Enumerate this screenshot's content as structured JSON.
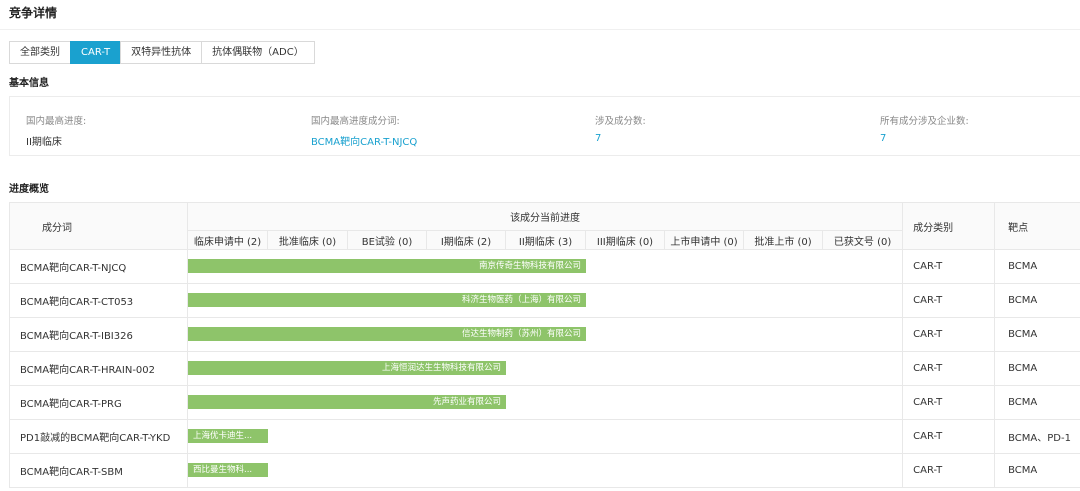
{
  "page_title": "竞争详情",
  "tabs": [
    {
      "label": "全部类别",
      "active": false
    },
    {
      "label": "CAR-T",
      "active": true
    },
    {
      "label": "双特异性抗体",
      "active": false
    },
    {
      "label": "抗体偶联物（ADC）",
      "active": false
    }
  ],
  "basic_info": {
    "section_title": "基本信息",
    "highest_progress": {
      "label": "国内最高进度:",
      "value": "II期临床"
    },
    "highest_progress_component": {
      "label": "国内最高进度成分词:",
      "value": "BCMA靶向CAR-T-NJCQ"
    },
    "component_count": {
      "label": "涉及成分数:",
      "value": "7"
    },
    "company_count": {
      "label": "所有成分涉及企业数:",
      "value": "7"
    }
  },
  "progress": {
    "section_title": "进度概览",
    "columns": {
      "component": "成分词",
      "current_progress": "该成分当前进度",
      "category": "成分类别",
      "target": "靶点"
    },
    "stages": [
      "临床申请中 (2)",
      "批准临床 (0)",
      "BE试验 (0)",
      "I期临床 (2)",
      "II期临床 (3)",
      "III期临床 (0)",
      "上市申请中 (0)",
      "批准上市 (0)",
      "已获文号 (0)"
    ],
    "colors": {
      "bar": "#8ec46a",
      "link": "#1aa1cf",
      "active_tab": "#1aa1cf"
    },
    "rows": [
      {
        "name": "BCMA靶向CAR-T-NJCQ",
        "company": "南京传奇生物科技有限公司",
        "stage_index": 4,
        "category": "CAR-T",
        "target": "BCMA"
      },
      {
        "name": "BCMA靶向CAR-T-CT053",
        "company": "科济生物医药（上海）有限公司",
        "stage_index": 4,
        "category": "CAR-T",
        "target": "BCMA"
      },
      {
        "name": "BCMA靶向CAR-T-IBI326",
        "company": "信达生物制药（苏州）有限公司",
        "stage_index": 4,
        "category": "CAR-T",
        "target": "BCMA"
      },
      {
        "name": "BCMA靶向CAR-T-HRAIN-002",
        "company": "上海恒润达生生物科技有限公司",
        "stage_index": 3,
        "category": "CAR-T",
        "target": "BCMA"
      },
      {
        "name": "BCMA靶向CAR-T-PRG",
        "company": "先声药业有限公司",
        "stage_index": 3,
        "category": "CAR-T",
        "target": "BCMA"
      },
      {
        "name": "PD1敲减的BCMA靶向CAR-T-YKD",
        "company": "上海优卡迪生...",
        "stage_index": 0,
        "category": "CAR-T",
        "target": "BCMA、PD-1"
      },
      {
        "name": "BCMA靶向CAR-T-SBM",
        "company": "西比曼生物科...",
        "stage_index": 0,
        "category": "CAR-T",
        "target": "BCMA"
      }
    ]
  }
}
